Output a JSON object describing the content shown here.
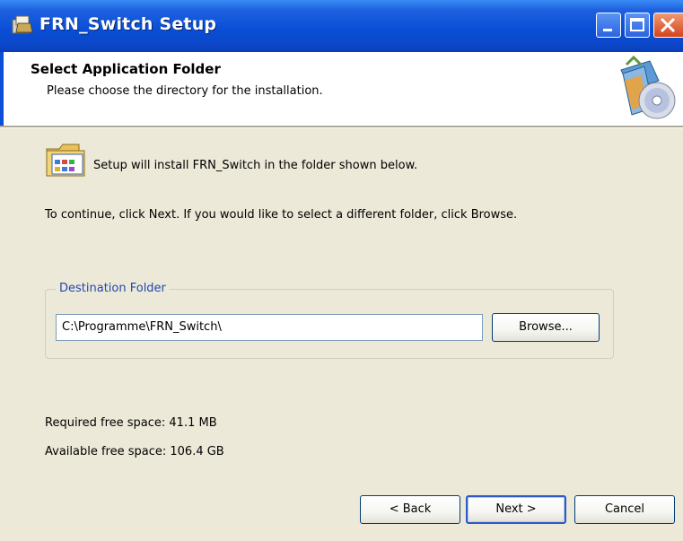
{
  "window": {
    "title": "FRN_Switch Setup",
    "icon": "setup-icon"
  },
  "title_buttons": {
    "minimize_icon": "minimize-icon",
    "maximize_icon": "maximize-icon",
    "close_icon": "close-icon"
  },
  "header": {
    "title": "Select Application Folder",
    "subtitle": "Please choose the directory for the installation.",
    "icon": "install-cd-icon"
  },
  "body": {
    "intro": "Setup will install FRN_Switch in the folder shown below.",
    "instruction": "To continue, click Next. If you would like to select a different folder, click Browse.",
    "intro_icon": "folder-icon"
  },
  "destination": {
    "label": "Destination Folder",
    "path": "C:\\Programme\\FRN_Switch\\",
    "browse_label": "Browse..."
  },
  "space": {
    "required": "Required free space: 41.1 MB",
    "available": "Available free space: 106.4 GB"
  },
  "buttons": {
    "back": "< Back",
    "next": "Next >",
    "cancel": "Cancel"
  },
  "colors": {
    "titlebar": "#0a4fd6",
    "face": "#ece9d8",
    "group_label": "#2148b0",
    "close_button": "#d4431c"
  }
}
